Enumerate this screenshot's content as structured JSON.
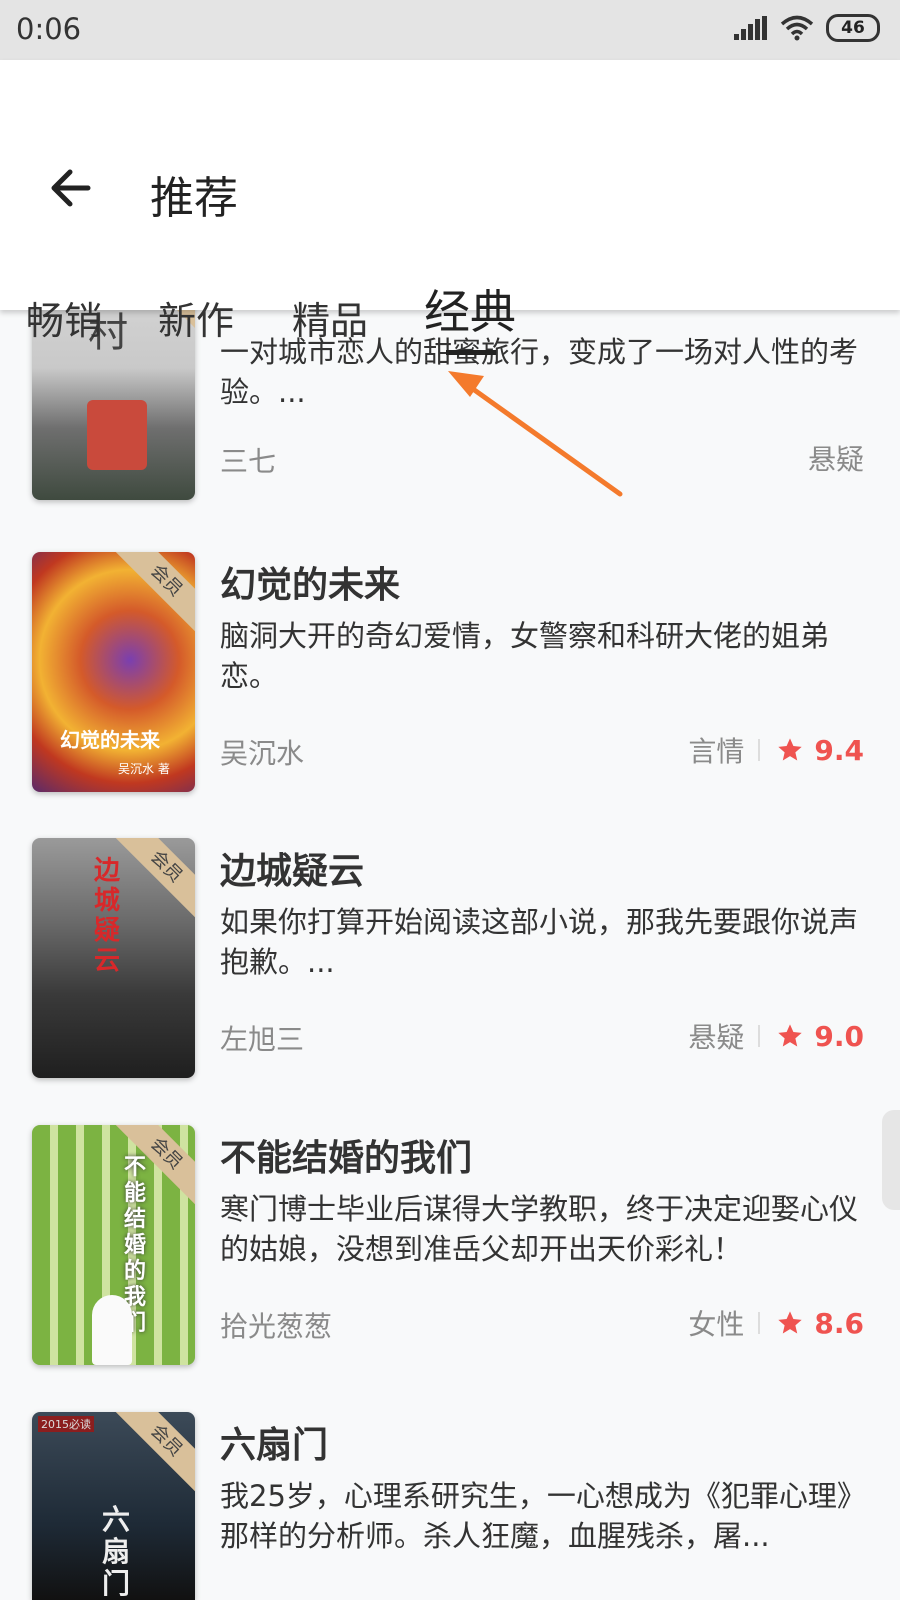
{
  "status_bar": {
    "time": "0:06",
    "battery": "46"
  },
  "header": {
    "title": "推荐",
    "tabs": [
      "畅销",
      "新作",
      "精品",
      "经典"
    ],
    "active_tab": "经典"
  },
  "books": [
    {
      "cover_text": "村",
      "description": "一对城市恋人的甜蜜旅行，变成了一场对人性的考验。...",
      "author": "三七",
      "genre": "悬疑"
    },
    {
      "title": "幻觉的未来",
      "cover_badge": "会员",
      "cover_title": "幻觉的未来",
      "cover_author": "吴沉水 著",
      "description": "脑洞大开的奇幻爱情，女警察和科研大佬的姐弟恋。",
      "author": "吴沉水",
      "genre": "言情",
      "rating": "9.4"
    },
    {
      "title": "边城疑云",
      "cover_badge": "会员",
      "cover_title": "边城疑云",
      "description": "如果你打算开始阅读这部小说，那我先要跟你说声抱歉。...",
      "author": "左旭三",
      "genre": "悬疑",
      "rating": "9.0"
    },
    {
      "title": "不能结婚的我们",
      "cover_badge": "会员",
      "cover_title": "不能结婚的我们",
      "description": "寒门博士毕业后谋得大学教职，终于决定迎娶心仪的姑娘，没想到准岳父却开出天价彩礼！",
      "author": "拾光葱葱",
      "genre": "女性",
      "rating": "8.6"
    },
    {
      "title": "六扇门",
      "cover_badge": "会员",
      "cover_tag": "2015必读",
      "cover_title": "六扇门",
      "description": "我25岁，心理系研究生，一心想成为《犯罪心理》那样的分析师。杀人狂魔，血腥残杀，屠..."
    }
  ],
  "colors": {
    "rating": "#ef5350",
    "annotation_arrow": "#f47a2c",
    "badge": "#d9c09a"
  },
  "icons": {
    "back": "arrow-left-icon",
    "star": "star-icon",
    "signal": "signal-icon",
    "wifi": "wifi-icon"
  }
}
